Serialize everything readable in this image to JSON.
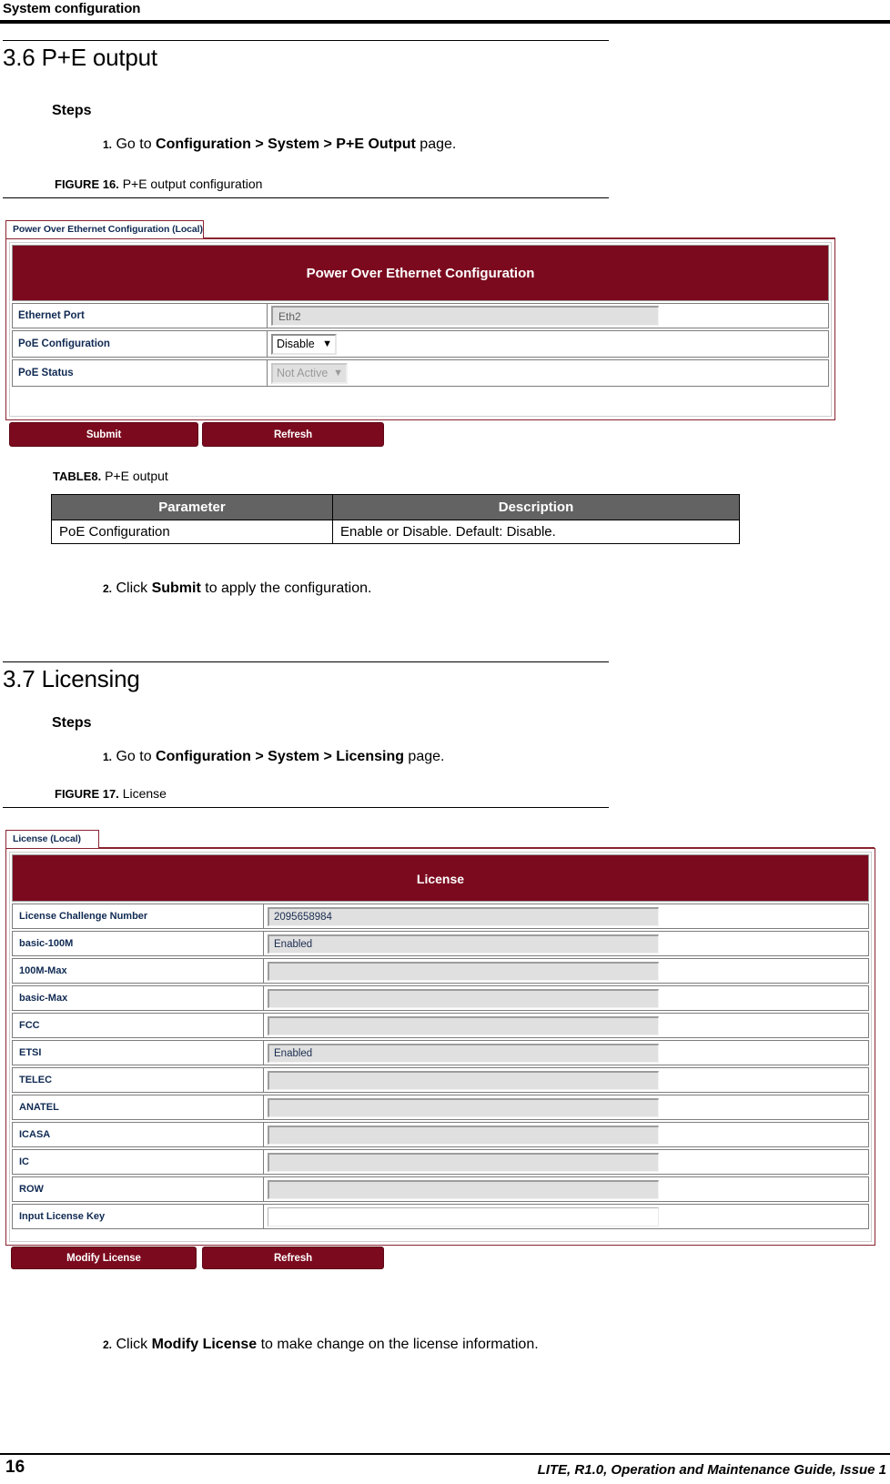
{
  "header": {
    "running_title": "System configuration"
  },
  "footer": {
    "page_number": "16",
    "guide_title": "LITE, R1.0, Operation and Maintenance Guide, Issue 1"
  },
  "colors": {
    "panel_accent": "#7b0a1e",
    "panel_border": "#8a2330",
    "table_header": "#636363",
    "label_text": "#102a53"
  },
  "sections": [
    {
      "number_title": "3.6 P+E output",
      "steps_label": "Steps",
      "step1_prefix": "1.",
      "step1_pre": "Go to ",
      "step1_bold": "Configuration > System > P+E Output",
      "step1_post": " page.",
      "figure_label": "FIGURE 16.",
      "figure_caption": "P+E output configuration",
      "step2_prefix": "2.",
      "step2_pre": "Click ",
      "step2_bold": "Submit",
      "step2_post": " to apply the configuration."
    },
    {
      "number_title": "3.7 Licensing",
      "steps_label": "Steps",
      "step1_prefix": "1.",
      "step1_pre": "Go to ",
      "step1_bold": "Configuration > System > Licensing",
      "step1_post": " page.",
      "figure_label": "FIGURE 17.",
      "figure_caption": "License",
      "step2_prefix": "2.",
      "step2_pre": "Click ",
      "step2_bold": "Modify License",
      "step2_post": " to make change on the license information."
    }
  ],
  "poe_figure": {
    "tab_label": "Power Over Ethernet Configuration (Local)",
    "panel_title": "Power Over Ethernet Configuration",
    "rows": [
      {
        "label": "Ethernet Port",
        "value": "Eth2",
        "control": "textbox-disabled"
      },
      {
        "label": "PoE Configuration",
        "value": "Disable",
        "control": "select"
      },
      {
        "label": "PoE Status",
        "value": "Not Active",
        "control": "select-disabled"
      }
    ],
    "buttons": [
      {
        "label": "Submit"
      },
      {
        "label": "Refresh"
      }
    ]
  },
  "poe_table": {
    "caption_label": "TABLE8.",
    "caption_text": "P+E output",
    "columns": [
      "Parameter",
      "Description"
    ],
    "rows": [
      [
        "PoE Configuration",
        "Enable or Disable. Default: Disable."
      ]
    ]
  },
  "license_figure": {
    "tab_label": "License (Local)",
    "panel_title": "License",
    "rows": [
      {
        "label": "License Challenge Number",
        "value": "2095658984",
        "control": "textbox-disabled"
      },
      {
        "label": "basic-100M",
        "value": "Enabled",
        "control": "textbox-disabled"
      },
      {
        "label": "100M-Max",
        "value": "",
        "control": "textbox-disabled"
      },
      {
        "label": "basic-Max",
        "value": "",
        "control": "textbox-disabled"
      },
      {
        "label": "FCC",
        "value": "",
        "control": "textbox-disabled"
      },
      {
        "label": "ETSI",
        "value": "Enabled",
        "control": "textbox-disabled"
      },
      {
        "label": "TELEC",
        "value": "",
        "control": "textbox-disabled"
      },
      {
        "label": "ANATEL",
        "value": "",
        "control": "textbox-disabled"
      },
      {
        "label": "ICASA",
        "value": "",
        "control": "textbox-disabled"
      },
      {
        "label": "IC",
        "value": "",
        "control": "textbox-disabled"
      },
      {
        "label": "ROW",
        "value": "",
        "control": "textbox-disabled"
      },
      {
        "label": "Input License Key",
        "value": "",
        "control": "textbox-editable"
      }
    ],
    "buttons": [
      {
        "label": "Modify License"
      },
      {
        "label": "Refresh"
      }
    ]
  }
}
